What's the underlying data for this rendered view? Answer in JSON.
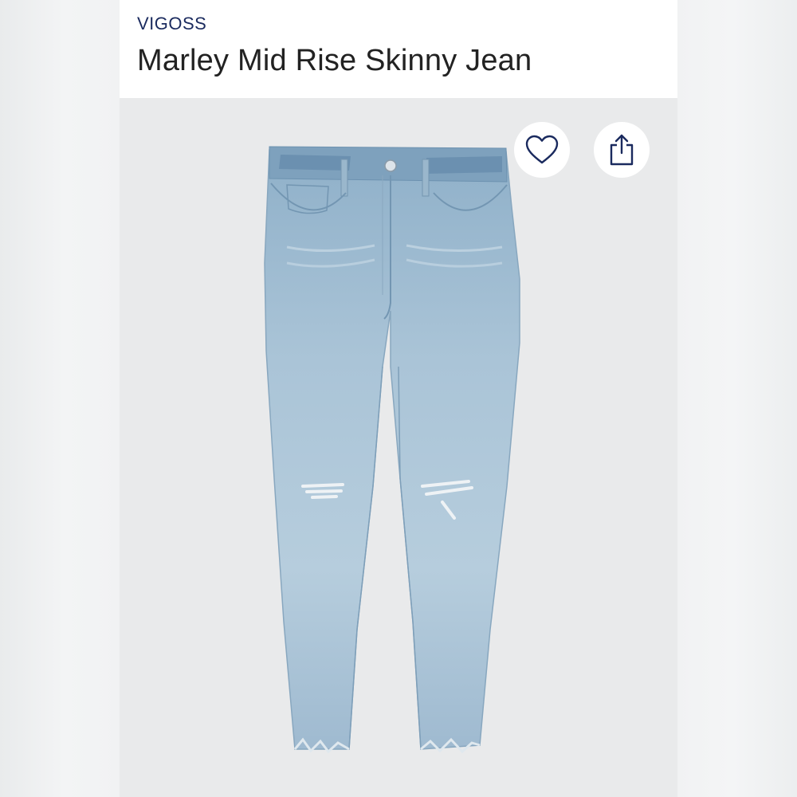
{
  "header": {
    "brand": "VIGOSS",
    "title": "Marley Mid Rise Skinny Jean"
  },
  "actions": {
    "favorite_icon": "heart-outline-icon",
    "share_icon": "share-upload-icon"
  },
  "product_image": {
    "subject": "light wash distressed skinny jeans",
    "colors": {
      "denim_light": "#a9c3d6",
      "denim_mid": "#8fb0c9",
      "denim_dark": "#5f86a6",
      "icon_navy": "#1a2a5e"
    }
  }
}
